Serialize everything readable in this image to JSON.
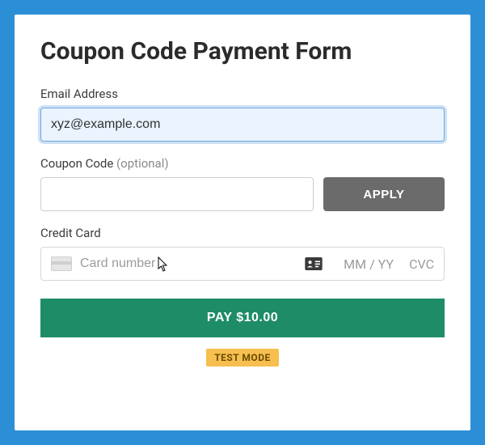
{
  "title": "Coupon Code Payment Form",
  "email": {
    "label": "Email Address",
    "value": "xyz@example.com"
  },
  "coupon": {
    "label": "Coupon Code",
    "optional": "(optional)",
    "value": "",
    "apply_label": "APPLY"
  },
  "card": {
    "label": "Credit Card",
    "number_placeholder": "Card number",
    "exp_placeholder": "MM / YY",
    "cvc_placeholder": "CVC"
  },
  "pay_label": "PAY $10.00",
  "test_mode_label": "TEST MODE"
}
